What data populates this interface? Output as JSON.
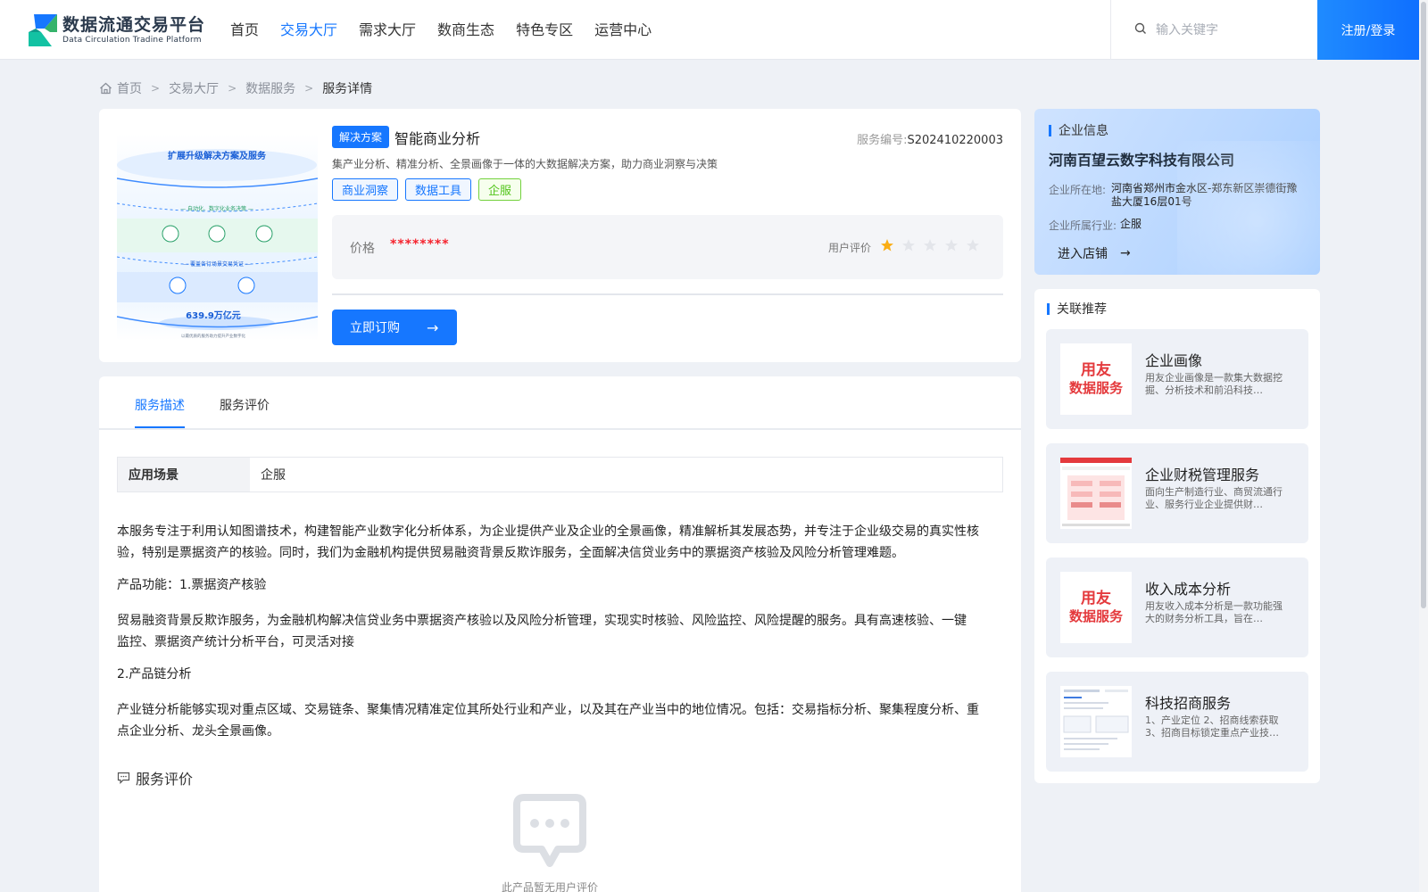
{
  "header": {
    "logo_title": "数据流通交易平台",
    "logo_sub": "Data Circulation Tradine Platform",
    "nav": [
      {
        "label": "首页",
        "active": false
      },
      {
        "label": "交易大厅",
        "active": true
      },
      {
        "label": "需求大厅",
        "active": false
      },
      {
        "label": "数商生态",
        "active": false
      },
      {
        "label": "特色专区",
        "active": false
      },
      {
        "label": "运营中心",
        "active": false
      }
    ],
    "search_placeholder": "输入关键字",
    "login_label": "注册/登录"
  },
  "breadcrumb": {
    "home": "首页",
    "level1": "交易大厅",
    "level2": "数据服务",
    "current": "服务详情"
  },
  "product": {
    "tag": "解决方案",
    "title": "智能商业分析",
    "service_no_label": "服务编号:",
    "service_no": "S202410220003",
    "description": "集产业分析、精准分析、全景画像于一体的大数据解决方案，助力商业洞察与决策",
    "tags": [
      "商业洞察",
      "数据工具",
      "企服"
    ],
    "price_label": "价格",
    "price_value": "********",
    "rating_label": "用户评价",
    "rating": 1,
    "rating_max": 5,
    "buy_label": "立即订购",
    "thumb": {
      "title": "扩展升级解决方案及服务",
      "line1": "— 自动化、数字化业务决策 —",
      "line2": "— 覆盖各行场景交易凭证 —",
      "big": "639.9万亿元",
      "foot": "以最优质的服务助力提升产业数字化"
    }
  },
  "company": {
    "section_title": "企业信息",
    "name": "河南百望云数字科技有限公司",
    "location_label": "企业所在地:",
    "location": "河南省郑州市金水区-郑东新区崇德街豫盐大厦16层01号",
    "industry_label": "企业所属行业:",
    "industry": "企服",
    "enter_label": "进入店铺"
  },
  "related": {
    "section_title": "关联推荐",
    "items": [
      {
        "title": "企业画像",
        "desc": "用友企业画像是一款集大数据挖掘、分析技术和前沿科技…",
        "logo_a": "用友",
        "logo_b": "数据服务"
      },
      {
        "title": "企业财税管理服务",
        "desc": "面向生产制造行业、商贸流通行业、服务行业企业提供财…"
      },
      {
        "title": "收入成本分析",
        "desc": "用友收入成本分析是一款功能强大的财务分析工具，旨在…",
        "logo_a": "用友",
        "logo_b": "数据服务"
      },
      {
        "title": "科技招商服务",
        "desc": "1、产业定位 2、招商线索获取 3、招商目标锁定重点产业技…"
      }
    ]
  },
  "detail": {
    "tabs": [
      {
        "label": "服务描述",
        "active": true
      },
      {
        "label": "服务评价",
        "active": false
      }
    ],
    "scene_label": "应用场景",
    "scene_value": "企服",
    "p1": "本服务专注于利用认知图谱技术，构建智能产业数字化分析体系，为企业提供产业及企业的全景画像，精准解析其发展态势，并专注于企业级交易的真实性核验，特别是票据资产的核验。同时，我们为金融机构提供贸易融资背景反欺诈服务，全面解决信贷业务中的票据资产核验及风险分析管理难题。",
    "p2": "产品功能：1.票据资产核验",
    "p3": "贸易融资背景反欺诈服务，为金融机构解决信贷业务中票据资产核验以及风险分析管理，实现实时核验、风险监控、风险提醒的服务。具有高速核验、一键监控、票据资产统计分析平台，可灵活对接",
    "p4": "2.产品链分析",
    "p5": "产业链分析能够实现对重点区域、交易链条、聚集情况精准定位其所处行业和产业，以及其在产业当中的地位情况。包括：交易指标分析、聚集程度分析、重点企业分析、龙头全景画像。",
    "review_title": "服务评价",
    "empty_text": "此产品暂无用户评价"
  },
  "colors": {
    "accent": "#1677ff",
    "price": "#f5222d",
    "star_on": "#faad14",
    "star_off": "#e3e5ea"
  }
}
